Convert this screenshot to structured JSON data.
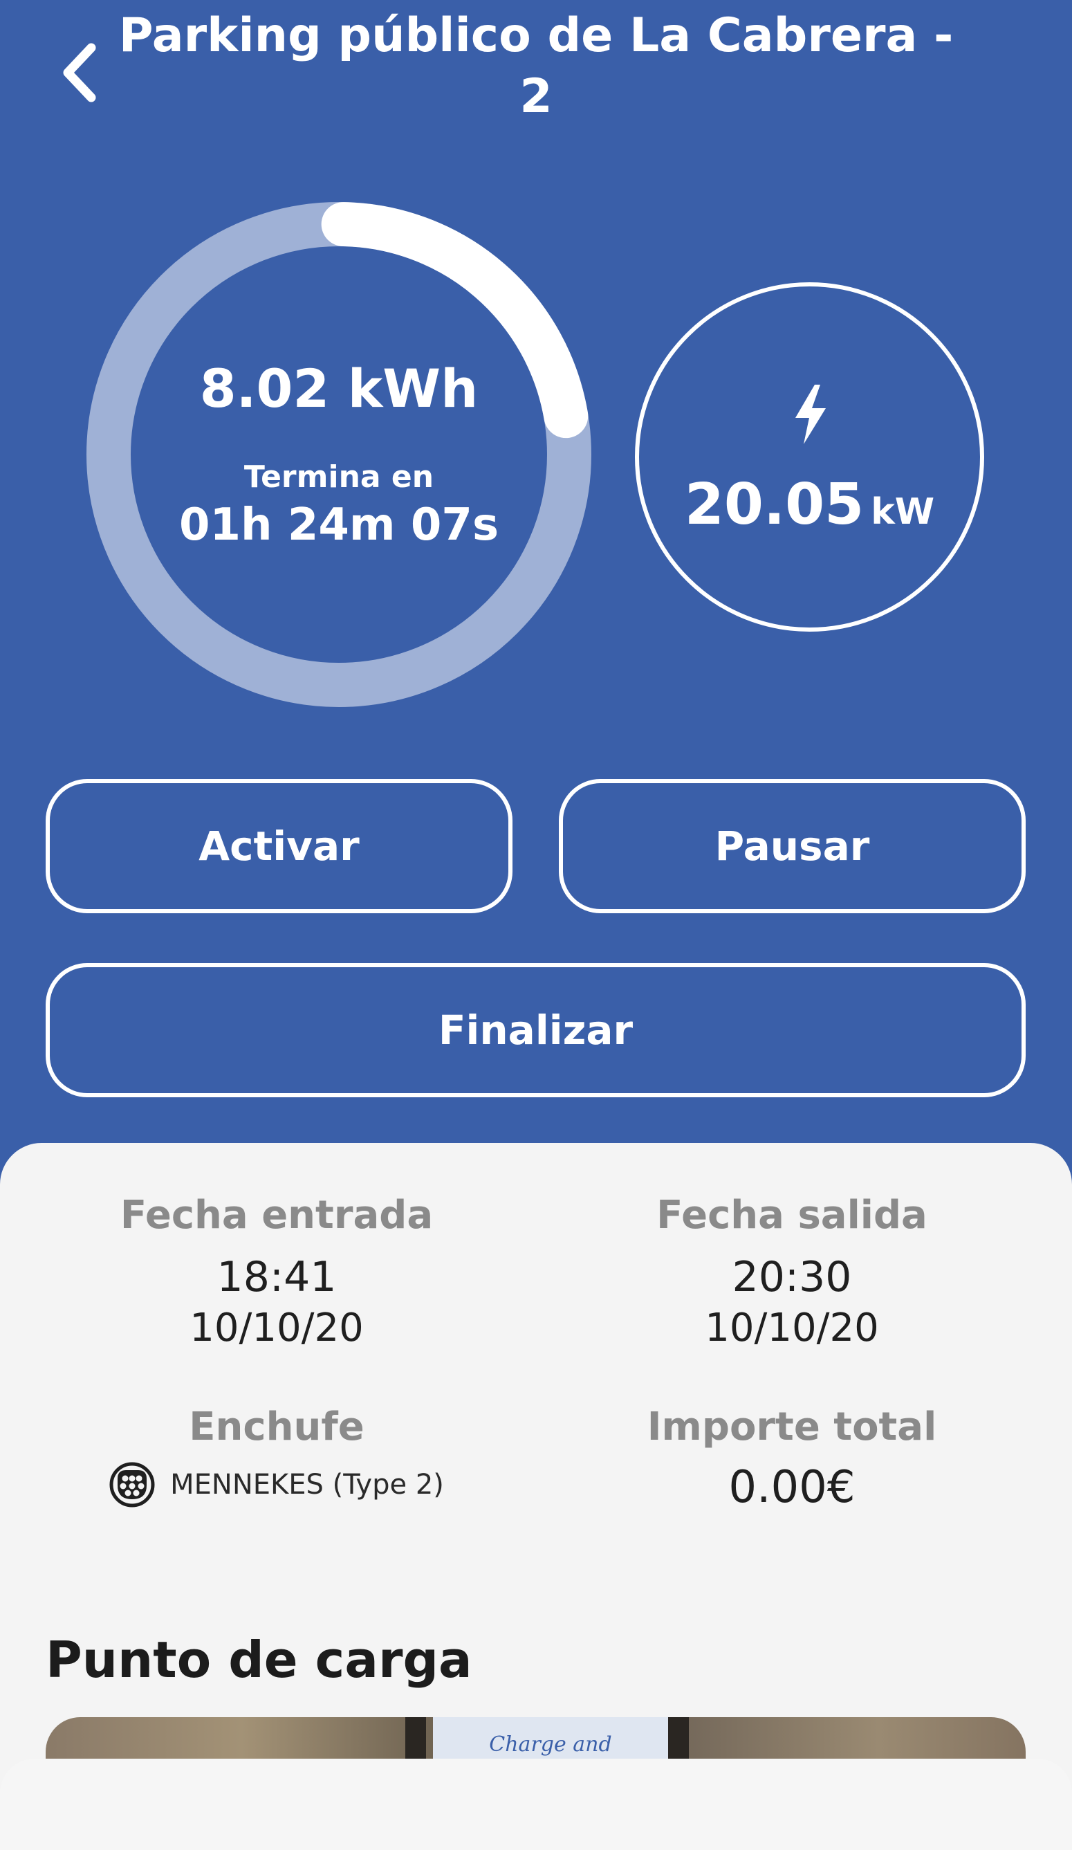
{
  "header": {
    "title_line1": "Parking público de La Cabrera -",
    "title_line2": "2",
    "back_icon": "chevron-left-icon"
  },
  "energy": {
    "value": "8.02 kWh",
    "ends_label": "Termina en",
    "ends_time": "01h 24m 07s",
    "progress_fraction": 0.22
  },
  "power": {
    "icon": "lightning-bolt-icon",
    "value": "20.05",
    "unit": "kW"
  },
  "actions": {
    "activate_label": "Activar",
    "pause_label": "Pausar",
    "finish_label": "Finalizar"
  },
  "details": {
    "entry_label": "Fecha entrada",
    "entry_time": "18:41",
    "entry_date": "10/10/20",
    "exit_label": "Fecha salida",
    "exit_time": "20:30",
    "exit_date": "10/10/20",
    "plug_label": "Enchufe",
    "plug_icon": "type2-connector-icon",
    "plug_type": "MENNEKES (Type 2)",
    "total_label": "Importe total",
    "total_value": "0.00€"
  },
  "charge_point": {
    "section_title": "Punto de carga",
    "photo_sign_text": "Charge and Parking"
  },
  "colors": {
    "primary": "#3a5fa9",
    "card_bg": "#f4f4f4",
    "ring_track": "#9fb1d6",
    "ring_progress": "#ffffff"
  }
}
